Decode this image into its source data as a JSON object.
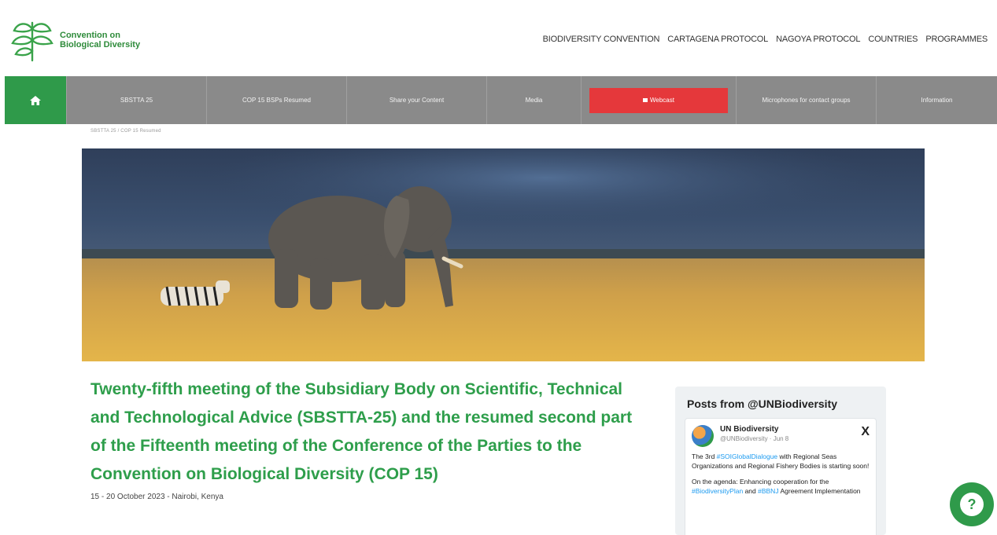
{
  "header": {
    "logo_text_line1": "Convention on",
    "logo_text_line2": "Biological Diversity",
    "nav": [
      "BIODIVERSITY CONVENTION",
      "CARTAGENA PROTOCOL",
      "NAGOYA PROTOCOL",
      "COUNTRIES",
      "PROGRAMMES"
    ]
  },
  "menubar": {
    "home_icon": "home-icon",
    "items": [
      "SBSTTA 25",
      "COP 15 BSPs Resumed",
      "Share your Content",
      "Media",
      "Webcast",
      "Microphones for contact groups",
      "Information"
    ],
    "webcast_color": "#e5383b",
    "home_color": "#2f9a4a"
  },
  "breadcrumb": "SBSTTA 25 / COP 15 Resumed",
  "hero": {
    "image": "elephant-and-zebra-savanna"
  },
  "main": {
    "title": "Twenty-fifth meeting of the Subsidiary Body on Scientific, Technical and Technological Advice (SBSTTA-25) and the resumed second part of the Fifteenth meeting of the Conference of the Parties to the Convention on Biological Diversity (COP 15)",
    "date": "15 - 20 October 2023 - Nairobi, Kenya",
    "title_color": "#2e9e4b"
  },
  "social": {
    "title": "Posts from @UNBiodiversity",
    "tweet": {
      "name": "UN Biodiversity",
      "handle": "@UNBiodiversity · Jun 8",
      "text1_pre": "The 3rd ",
      "text1_tag": "#SOIGlobalDialogue",
      "text1_post": " with Regional Seas Organizations and Regional Fishery Bodies is starting soon!",
      "text2_pre": "On the agenda: Enhancing cooperation for the ",
      "text2_tag1": "#BiodiversityPlan",
      "text2_mid": " and ",
      "text2_tag2": "#BBNJ",
      "text2_post": " Agreement Implementation"
    }
  },
  "help": {
    "label": "?"
  }
}
